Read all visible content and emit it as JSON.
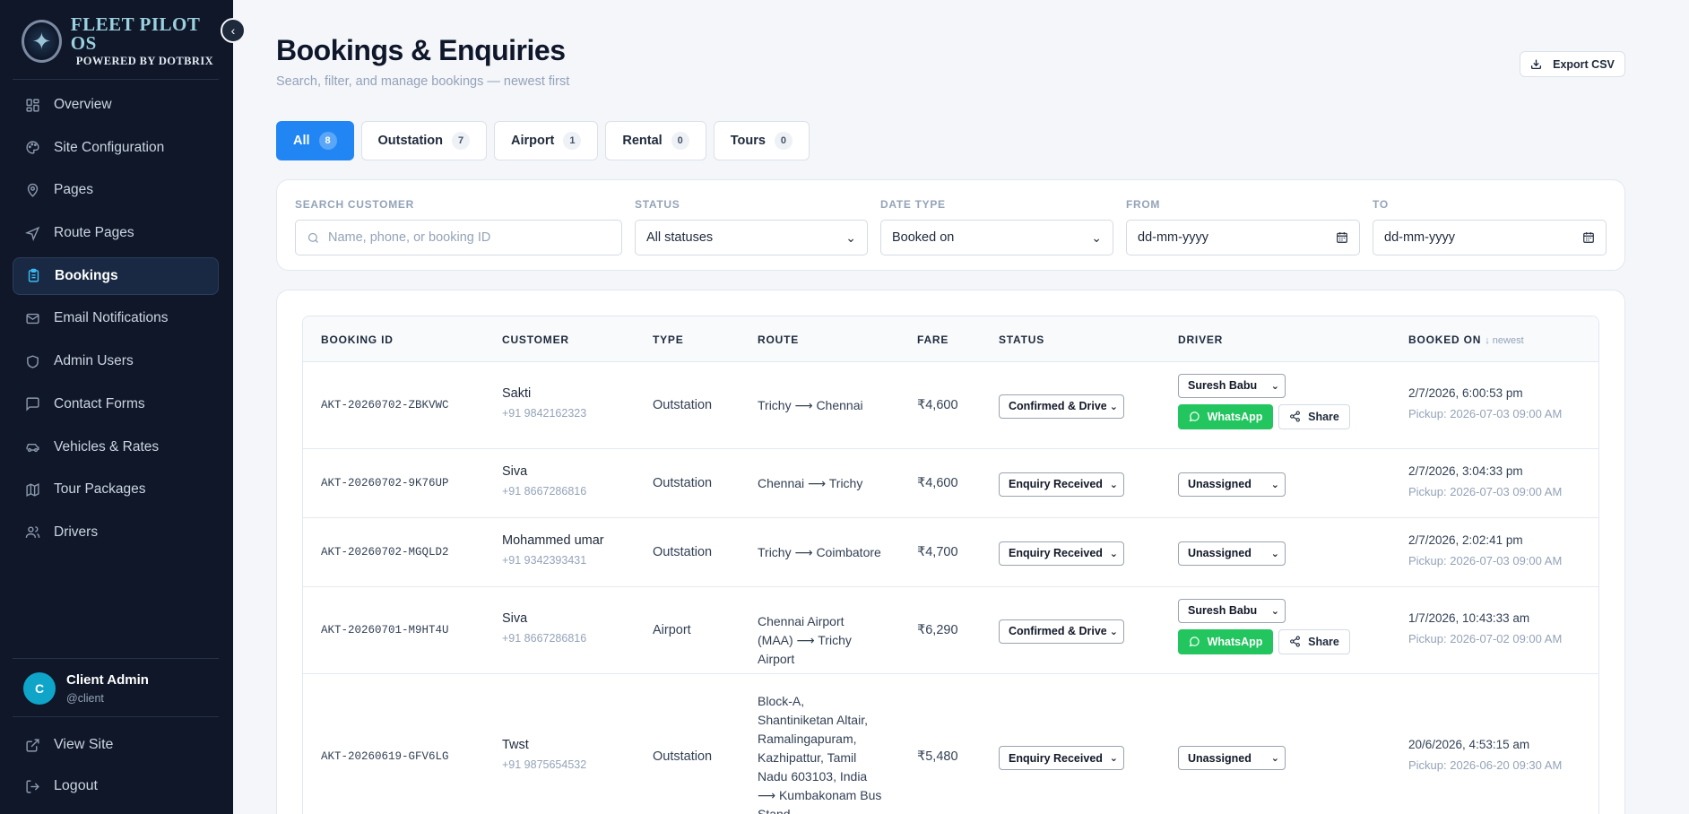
{
  "brand": {
    "title": "FLEET PILOT OS",
    "subtitle": "POWERED BY DOTBRIX"
  },
  "sidebar": {
    "items": [
      {
        "label": "Overview",
        "icon": "grid-icon"
      },
      {
        "label": "Site Configuration",
        "icon": "palette-icon"
      },
      {
        "label": "Pages",
        "icon": "map-pin-icon"
      },
      {
        "label": "Route Pages",
        "icon": "navigation-icon"
      },
      {
        "label": "Bookings",
        "icon": "clipboard-icon",
        "active": true
      },
      {
        "label": "Email Notifications",
        "icon": "mail-icon"
      },
      {
        "label": "Admin Users",
        "icon": "shield-icon"
      },
      {
        "label": "Contact Forms",
        "icon": "message-icon"
      },
      {
        "label": "Vehicles & Rates",
        "icon": "car-icon"
      },
      {
        "label": "Tour Packages",
        "icon": "map-icon"
      },
      {
        "label": "Drivers",
        "icon": "users-icon"
      }
    ],
    "user": {
      "initial": "C",
      "name": "Client Admin",
      "handle": "@client"
    },
    "bottom": {
      "view_site": "View Site",
      "logout": "Logout"
    }
  },
  "header": {
    "title": "Bookings & Enquiries",
    "subtitle": "Search, filter, and manage bookings — newest first",
    "export_label": "Export CSV"
  },
  "tabs": [
    {
      "label": "All",
      "count": "8",
      "active": true
    },
    {
      "label": "Outstation",
      "count": "7"
    },
    {
      "label": "Airport",
      "count": "1"
    },
    {
      "label": "Rental",
      "count": "0"
    },
    {
      "label": "Tours",
      "count": "0"
    }
  ],
  "filters": {
    "search": {
      "label": "SEARCH CUSTOMER",
      "placeholder": "Name, phone, or booking ID"
    },
    "status": {
      "label": "STATUS",
      "value": "All statuses"
    },
    "date_type": {
      "label": "DATE TYPE",
      "value": "Booked on"
    },
    "from": {
      "label": "FROM",
      "value": "dd-mm-yyyy"
    },
    "to": {
      "label": "TO",
      "value": "dd-mm-yyyy"
    }
  },
  "table": {
    "headers": {
      "booking_id": "BOOKING ID",
      "customer": "CUSTOMER",
      "type": "TYPE",
      "route": "ROUTE",
      "fare": "FARE",
      "status": "STATUS",
      "driver": "DRIVER",
      "booked_on": "BOOKED ON",
      "sort_hint": "↓ newest"
    },
    "rows": [
      {
        "id": "AKT-20260702-ZBKVWC",
        "name": "Sakti",
        "phone": "+91 9842162323",
        "type": "Outstation",
        "route": "Trichy ⟶ Chennai",
        "fare": "₹4,600",
        "status": "Confirmed & Driver Assigned",
        "driver": "Suresh Babu",
        "actions": true,
        "whatsapp": "WhatsApp",
        "share": "Share",
        "booked": "2/7/2026, 6:00:53 pm",
        "pickup": "Pickup: 2026-07-03 09:00 AM"
      },
      {
        "id": "AKT-20260702-9K76UP",
        "name": "Siva",
        "phone": "+91 8667286816",
        "type": "Outstation",
        "route": "Chennai ⟶ Trichy",
        "fare": "₹4,600",
        "status": "Enquiry Received",
        "driver": "Unassigned",
        "actions": false,
        "booked": "2/7/2026, 3:04:33 pm",
        "pickup": "Pickup: 2026-07-03 09:00 AM"
      },
      {
        "id": "AKT-20260702-MGQLD2",
        "name": "Mohammed umar",
        "phone": "+91 9342393431",
        "type": "Outstation",
        "route": "Trichy ⟶ Coimbatore",
        "fare": "₹4,700",
        "status": "Enquiry Received",
        "driver": "Unassigned",
        "actions": false,
        "booked": "2/7/2026, 2:02:41 pm",
        "pickup": "Pickup: 2026-07-03 09:00 AM"
      },
      {
        "id": "AKT-20260701-M9HT4U",
        "name": "Siva",
        "phone": "+91 8667286816",
        "type": "Airport",
        "route": "Chennai Airport (MAA) ⟶ Trichy Airport",
        "fare": "₹6,290",
        "status": "Confirmed & Driver Assigned",
        "driver": "Suresh Babu",
        "actions": true,
        "whatsapp": "WhatsApp",
        "share": "Share",
        "booked": "1/7/2026, 10:43:33 am",
        "pickup": "Pickup: 2026-07-02 09:00 AM"
      },
      {
        "id": "AKT-20260619-GFV6LG",
        "name": "Twst",
        "phone": "+91 9875654532",
        "type": "Outstation",
        "route": "Block-A, Shantiniketan Altair, Ramalingapuram, Kazhipattur, Tamil Nadu 603103, India ⟶ Kumbakonam Bus Stand",
        "fare": "₹5,480",
        "status": "Enquiry Received",
        "driver": "Unassigned",
        "actions": false,
        "booked": "20/6/2026, 4:53:15 am",
        "pickup": "Pickup: 2026-06-20 09:30 AM"
      }
    ]
  },
  "colors": {
    "accent": "#2186f4",
    "sidebar_bg": "#0f1729",
    "whatsapp": "#22c55e"
  }
}
